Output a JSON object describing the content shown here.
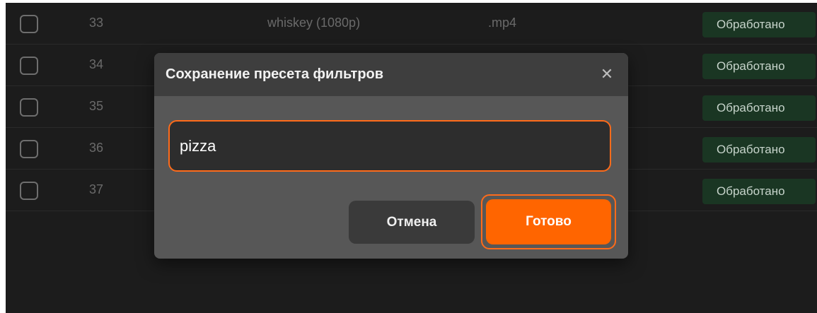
{
  "colors": {
    "background": "#1c1c1c",
    "status_badge_bg": "#1a3623",
    "accent": "#ff6500",
    "dialog_body": "#575757",
    "dialog_header": "#3e3e3e"
  },
  "table": {
    "rows": [
      {
        "number": "33",
        "name": "whiskey (1080p)",
        "ext": ".mp4",
        "status": "Обработано"
      },
      {
        "number": "34",
        "name": "",
        "ext": "",
        "status": "Обработано"
      },
      {
        "number": "35",
        "name": "",
        "ext": "",
        "status": "Обработано"
      },
      {
        "number": "36",
        "name": "",
        "ext": "",
        "status": "Обработано"
      },
      {
        "number": "37",
        "name": "",
        "ext": "",
        "status": "Обработано"
      }
    ]
  },
  "dialog": {
    "title": "Сохранение пресета фильтров",
    "close_icon": "close-icon",
    "input_value": "pizza",
    "cancel_label": "Отмена",
    "done_label": "Готово"
  }
}
